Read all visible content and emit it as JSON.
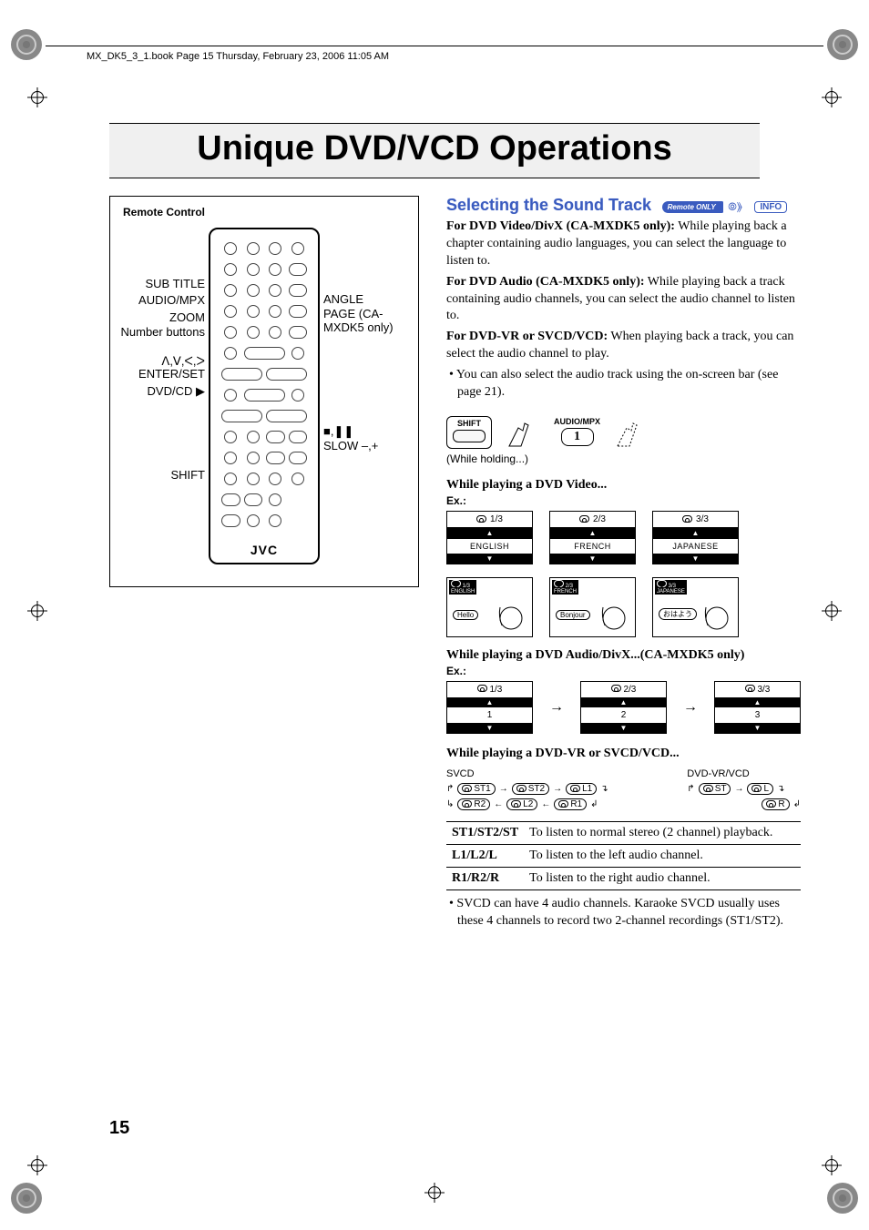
{
  "meta": {
    "book_tag": "MX_DK5_3_1.book  Page 15  Thursday, February 23, 2006  11:05 AM"
  },
  "title": "Unique DVD/VCD Operations",
  "remote": {
    "heading": "Remote Control",
    "logo": "JVC",
    "left_labels": {
      "subtitle": "SUB TITLE",
      "audio_mpx": "AUDIO/MPX",
      "zoom": "ZOOM",
      "number": "Number buttons",
      "cursor": "ᐱ,ᐯ,ᐸ,ᐳ ENTER/SET",
      "dvdcd": "DVD/CD ▶",
      "shift": "SHIFT"
    },
    "right_labels": {
      "angle": "ANGLE",
      "page": "PAGE (CA-MXDK5 only)",
      "stop_pause": "■,❚❚",
      "slow": "SLOW –,+"
    }
  },
  "section": {
    "heading": "Selecting the Sound Track",
    "badge_remote": "Remote ONLY",
    "badge_info": "INFO",
    "p1_bold": "For DVD Video/DivX (CA-MXDK5 only):",
    "p1_rest": " While playing back a chapter containing audio languages, you can select the language to listen to.",
    "p2_bold": "For DVD Audio (CA-MXDK5 only):",
    "p2_rest": " While playing back a track containing audio channels, you can select the audio channel to listen to.",
    "p3_bold": "For DVD-VR or SVCD/VCD:",
    "p3_rest": " When playing back a track, you can select the audio channel to play.",
    "bullet1": "You can also select the audio track using the on-screen bar (see page 21).",
    "shift_label": "SHIFT",
    "audio_label": "AUDIO/MPX",
    "audio_num": "1",
    "hold_note": "(While holding...)",
    "sub1": "While playing a DVD Video...",
    "ex": "Ex.:",
    "langs": [
      {
        "idx": "1/3",
        "name": "ENGLISH",
        "bubble": "Hello"
      },
      {
        "idx": "2/3",
        "name": "FRENCH",
        "bubble": "Bonjour"
      },
      {
        "idx": "3/3",
        "name": "JAPANESE",
        "bubble": "おはよう"
      }
    ],
    "sub2": "While playing a DVD Audio/DivX...(CA-MXDK5 only)",
    "audio_items": [
      {
        "idx": "1/3",
        "val": "1"
      },
      {
        "idx": "2/3",
        "val": "2"
      },
      {
        "idx": "3/3",
        "val": "3"
      }
    ],
    "sub3": "While playing a DVD-VR or SVCD/VCD...",
    "svcd_title": "SVCD",
    "svcd_cycle": [
      "ST1",
      "ST2",
      "L1",
      "R1",
      "L2",
      "R2"
    ],
    "dvdvr_title": "DVD-VR/VCD",
    "dvdvr_cycle": [
      "ST",
      "L",
      "R"
    ],
    "table": [
      {
        "k": "ST1/ST2/ST",
        "v": "To listen to normal stereo (2 channel) playback."
      },
      {
        "k": "L1/L2/L",
        "v": "To listen to the left audio channel."
      },
      {
        "k": "R1/R2/R",
        "v": "To listen to the right audio channel."
      }
    ],
    "footnote": "SVCD can have 4 audio channels. Karaoke SVCD usually uses these 4 channels to record two 2-channel recordings (ST1/ST2)."
  },
  "page_number": "15"
}
